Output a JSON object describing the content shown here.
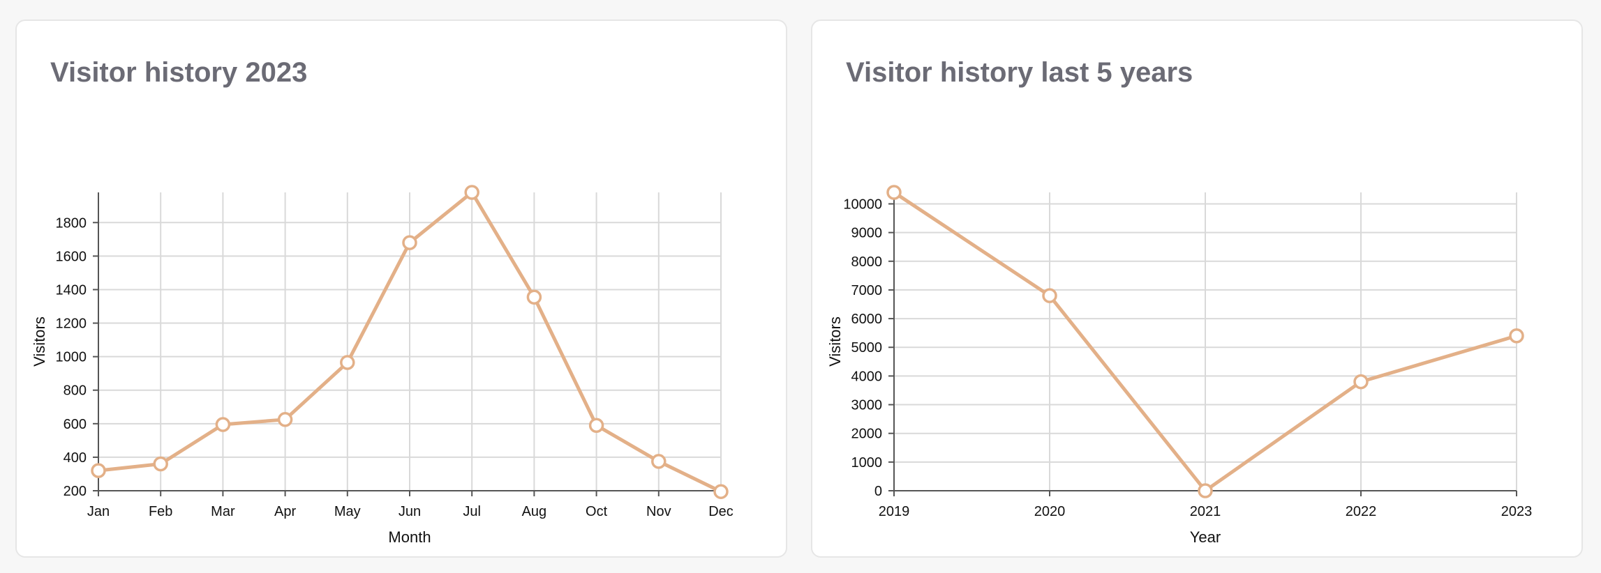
{
  "colors": {
    "background": "#f7f7f7",
    "card": "#ffffff",
    "title": "#6b6b75",
    "grid": "#d9d9d9",
    "axis": "#555555",
    "text": "#111111",
    "line": "#e3b088"
  },
  "cards": [
    {
      "title": "Visitor history 2023"
    },
    {
      "title": "Visitor history last 5 years"
    }
  ],
  "chart_data": [
    {
      "type": "line",
      "title": "Visitor history 2023",
      "xlabel": "Month",
      "ylabel": "Visitors",
      "categories": [
        "Jan",
        "Feb",
        "Mar",
        "Apr",
        "May",
        "Jun",
        "Jul",
        "Aug",
        "Oct",
        "Nov",
        "Dec"
      ],
      "series": [
        {
          "values": [
            320,
            360,
            595,
            625,
            965,
            1680,
            1980,
            1355,
            590,
            375,
            195
          ]
        }
      ],
      "yticks": [
        200,
        400,
        600,
        800,
        1000,
        1200,
        1400,
        1600,
        1800
      ],
      "ylim": [
        200,
        1980
      ],
      "grid": true,
      "markers": "hollow-circle"
    },
    {
      "type": "line",
      "title": "Visitor history last 5 years",
      "xlabel": "Year",
      "ylabel": "Visitors",
      "categories": [
        "2019",
        "2020",
        "2021",
        "2022",
        "2023"
      ],
      "series": [
        {
          "values": [
            10400,
            6800,
            0,
            3800,
            5400
          ]
        }
      ],
      "yticks": [
        0,
        1000,
        2000,
        3000,
        4000,
        5000,
        6000,
        7000,
        8000,
        9000,
        10000
      ],
      "ylim": [
        0,
        10400
      ],
      "grid": true,
      "markers": "hollow-circle"
    }
  ]
}
